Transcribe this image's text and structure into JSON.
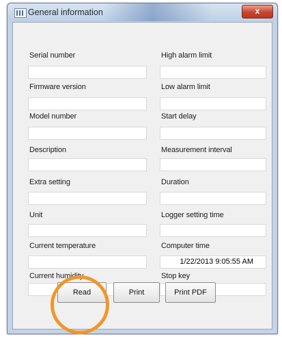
{
  "window": {
    "title": "General information",
    "close_label": "x"
  },
  "left_fields": [
    {
      "label": "Serial number",
      "value": ""
    },
    {
      "label": "Firmware version",
      "value": ""
    },
    {
      "label": "Model number",
      "value": ""
    },
    {
      "label": "Description",
      "value": ""
    },
    {
      "label": "Extra setting",
      "value": ""
    },
    {
      "label": "Unit",
      "value": ""
    },
    {
      "label": "Current temperature",
      "value": ""
    },
    {
      "label": "Current humidity",
      "value": ""
    }
  ],
  "right_fields": [
    {
      "label": "High alarm limit",
      "value": ""
    },
    {
      "label": "Low alarm limit",
      "value": ""
    },
    {
      "label": "Start delay",
      "value": ""
    },
    {
      "label": "Measurement interval",
      "value": ""
    },
    {
      "label": "Duration",
      "value": ""
    },
    {
      "label": "Logger setting time",
      "value": ""
    },
    {
      "label": "Computer time",
      "value": "1/22/2013 9:05:55 AM"
    },
    {
      "label": "Stop key",
      "value": ""
    }
  ],
  "buttons": {
    "read": "Read",
    "print": "Print",
    "print_pdf": "Print PDF"
  },
  "annotation": {
    "highlight_color": "#f0962a"
  }
}
